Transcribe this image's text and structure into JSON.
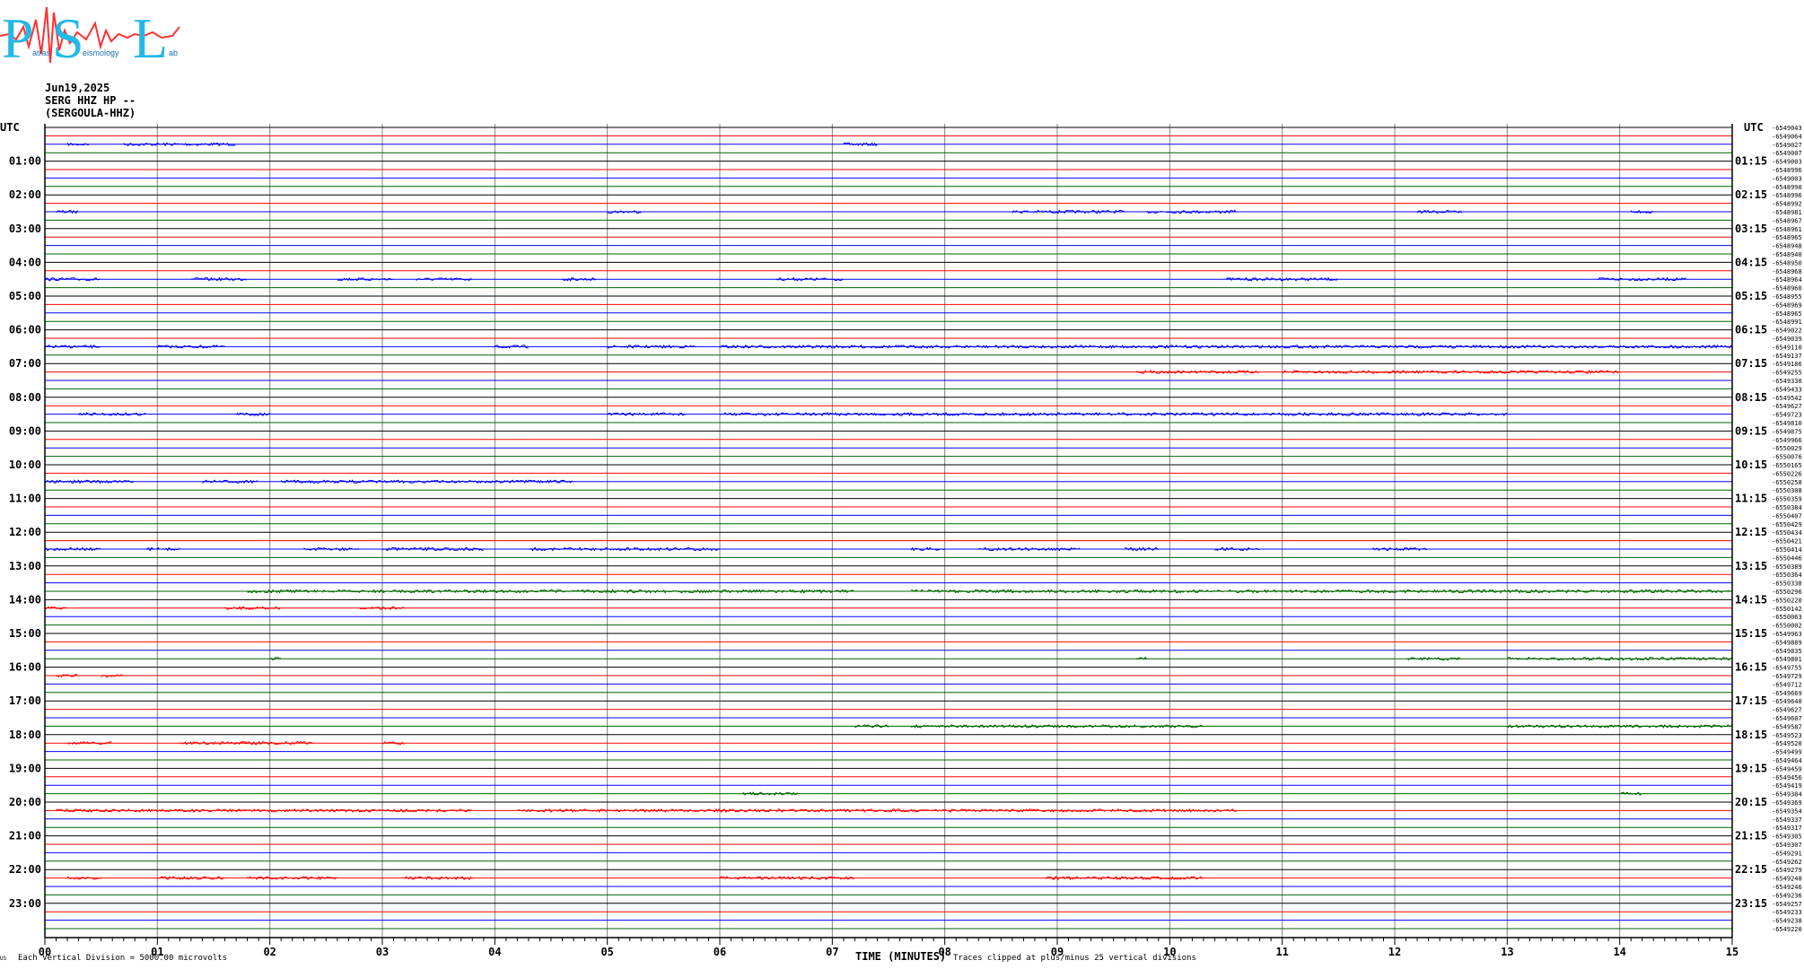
{
  "logo": {
    "letters": [
      "P",
      "S",
      "L"
    ],
    "small_text": [
      "atras",
      "eismology",
      "ab"
    ],
    "primary_color": "#22b8e6",
    "accent_color": "#ff3030"
  },
  "header": {
    "date": "Jun19,2025",
    "station": "SERG HHZ HP --",
    "location": "(SERGOULA-HHZ)"
  },
  "chart_data": {
    "type": "line",
    "title": "",
    "left_axis_label": "UTC",
    "right_axis_label": "UTC",
    "left_hour_labels": [
      "01:00",
      "02:00",
      "03:00",
      "04:00",
      "05:00",
      "06:00",
      "07:00",
      "08:00",
      "09:00",
      "10:00",
      "11:00",
      "12:00",
      "13:00",
      "14:00",
      "15:00",
      "16:00",
      "17:00",
      "18:00",
      "19:00",
      "20:00",
      "21:00",
      "22:00",
      "23:00"
    ],
    "right_hour_labels": [
      "01:15",
      "02:15",
      "03:15",
      "04:15",
      "05:15",
      "06:15",
      "07:15",
      "08:15",
      "09:15",
      "10:15",
      "11:15",
      "12:15",
      "13:15",
      "14:15",
      "15:15",
      "16:15",
      "17:15",
      "18:15",
      "19:15",
      "20:15",
      "21:15",
      "22:15",
      "23:15"
    ],
    "x_ticks": [
      "00",
      "01",
      "02",
      "03",
      "04",
      "05",
      "06",
      "07",
      "08",
      "09",
      "10",
      "11",
      "12",
      "13",
      "14",
      "15"
    ],
    "xlabel": "TIME (MINUTES)",
    "xlim": [
      0,
      15
    ],
    "trace_colors": [
      "#000000",
      "#ff0000",
      "#0000ff",
      "#006400"
    ],
    "grid_color": "#808080",
    "trace_count": 96,
    "right_offsets": [
      "-6549043",
      "-6549064",
      "-6549027",
      "-6549007",
      "-6549003",
      "-6548996",
      "-6549003",
      "-6548990",
      "-6548996",
      "-6548992",
      "-6548981",
      "-6548967",
      "-6548961",
      "-6548965",
      "-6548948",
      "-6548940",
      "-6548950",
      "-6548968",
      "-6548964",
      "-6548960",
      "-6548955",
      "-6548969",
      "-6548965",
      "-6548991",
      "-6549022",
      "-6549039",
      "-6549110",
      "-6549137",
      "-6549186",
      "-6549255",
      "-6549330",
      "-6549433",
      "-6549542",
      "-6549627",
      "-6549723",
      "-6549810",
      "-6549875",
      "-6549966",
      "-6550029",
      "-6550076",
      "-6550165",
      "-6550226",
      "-6550258",
      "-6550308",
      "-6550359",
      "-6550384",
      "-6550407",
      "-6550429",
      "-6550434",
      "-6550421",
      "-6550414",
      "-6550446",
      "-6550389",
      "-6550364",
      "-6550338",
      "-6550296",
      "-6550220",
      "-6550142",
      "-6550063",
      "-6550002",
      "-6549963",
      "-6549889",
      "-6549835",
      "-6549801",
      "-6549755",
      "-6549729",
      "-6549712",
      "-6549669",
      "-6549640",
      "-6549627",
      "-6549607",
      "-6549587",
      "-6549523",
      "-6549520",
      "-6549499",
      "-6549464",
      "-6549459",
      "-6549456",
      "-6549419",
      "-6549384",
      "-6549369",
      "-6549354",
      "-6549337",
      "-6549317",
      "-6549305",
      "-6549307",
      "-6549291",
      "-6549262",
      "-6549279",
      "-6549248",
      "-6549246",
      "-6549236",
      "-6549257",
      "-6549233",
      "-6549238",
      "-6549220"
    ],
    "footer_left": "Each Vertical Division = 5000.00 microvolts",
    "footer_right": "Traces clipped at plus/minus 25 vertical divisions",
    "corner_mark": "US",
    "activity": [
      {
        "trace": 2,
        "segments": [
          [
            0.2,
            0.4
          ],
          [
            0.7,
            1.7
          ],
          [
            7.1,
            7.4
          ]
        ]
      },
      {
        "trace": 10,
        "segments": [
          [
            0.1,
            0.3
          ],
          [
            5.0,
            5.3
          ],
          [
            8.6,
            9.6
          ],
          [
            9.8,
            10.6
          ],
          [
            12.2,
            12.6
          ],
          [
            14.1,
            14.3
          ]
        ]
      },
      {
        "trace": 18,
        "segments": [
          [
            0.0,
            0.5
          ],
          [
            1.3,
            1.8
          ],
          [
            2.6,
            3.1
          ],
          [
            3.3,
            3.8
          ],
          [
            4.6,
            4.9
          ],
          [
            6.5,
            7.1
          ],
          [
            10.5,
            11.5
          ],
          [
            13.8,
            14.6
          ]
        ]
      },
      {
        "trace": 26,
        "segments": [
          [
            0.0,
            0.5
          ],
          [
            1.0,
            1.6
          ],
          [
            4.0,
            4.3
          ],
          [
            5.0,
            5.8
          ],
          [
            6.0,
            15.0
          ]
        ]
      },
      {
        "trace": 29,
        "segments": [
          [
            9.7,
            10.8
          ],
          [
            11.0,
            14.0
          ]
        ]
      },
      {
        "trace": 34,
        "segments": [
          [
            0.3,
            0.9
          ],
          [
            1.7,
            2.0
          ],
          [
            5.0,
            5.7
          ],
          [
            6.0,
            9.5
          ],
          [
            9.5,
            13.0
          ]
        ]
      },
      {
        "trace": 42,
        "segments": [
          [
            0.0,
            0.8
          ],
          [
            1.4,
            1.9
          ],
          [
            2.1,
            4.7
          ]
        ]
      },
      {
        "trace": 50,
        "segments": [
          [
            0.0,
            0.5
          ],
          [
            0.9,
            1.2
          ],
          [
            2.3,
            2.8
          ],
          [
            3.0,
            3.9
          ],
          [
            4.3,
            6.0
          ],
          [
            7.7,
            8.0
          ],
          [
            8.3,
            9.2
          ],
          [
            9.6,
            9.9
          ],
          [
            10.4,
            10.8
          ],
          [
            11.8,
            12.3
          ]
        ]
      },
      {
        "trace": 55,
        "segments": [
          [
            1.8,
            3.3
          ],
          [
            3.3,
            7.2
          ],
          [
            7.7,
            15.0
          ]
        ]
      },
      {
        "trace": 57,
        "segments": [
          [
            0.0,
            0.2
          ],
          [
            1.6,
            2.1
          ],
          [
            2.8,
            3.2
          ]
        ]
      },
      {
        "trace": 63,
        "segments": [
          [
            2.0,
            2.1
          ],
          [
            9.7,
            9.8
          ],
          [
            12.1,
            12.6
          ],
          [
            13.0,
            15.0
          ]
        ]
      },
      {
        "trace": 65,
        "segments": [
          [
            0.1,
            0.3
          ],
          [
            0.5,
            0.7
          ]
        ]
      },
      {
        "trace": 71,
        "segments": [
          [
            7.2,
            7.5
          ],
          [
            7.7,
            10.3
          ],
          [
            13.0,
            15.0
          ]
        ]
      },
      {
        "trace": 73,
        "segments": [
          [
            0.2,
            0.6
          ],
          [
            1.2,
            1.8
          ],
          [
            1.7,
            2.4
          ],
          [
            3.0,
            3.2
          ]
        ]
      },
      {
        "trace": 79,
        "segments": [
          [
            6.2,
            6.7
          ],
          [
            14.0,
            14.2
          ]
        ]
      },
      {
        "trace": 81,
        "segments": [
          [
            0.1,
            1.3
          ],
          [
            1.3,
            3.8
          ],
          [
            4.2,
            5.0
          ],
          [
            5.0,
            8.2
          ],
          [
            8.2,
            10.6
          ]
        ]
      },
      {
        "trace": 89,
        "segments": [
          [
            0.2,
            0.5
          ],
          [
            1.0,
            1.6
          ],
          [
            1.8,
            2.6
          ],
          [
            3.2,
            3.8
          ],
          [
            6.0,
            7.2
          ],
          [
            8.9,
            10.3
          ]
        ]
      }
    ]
  }
}
